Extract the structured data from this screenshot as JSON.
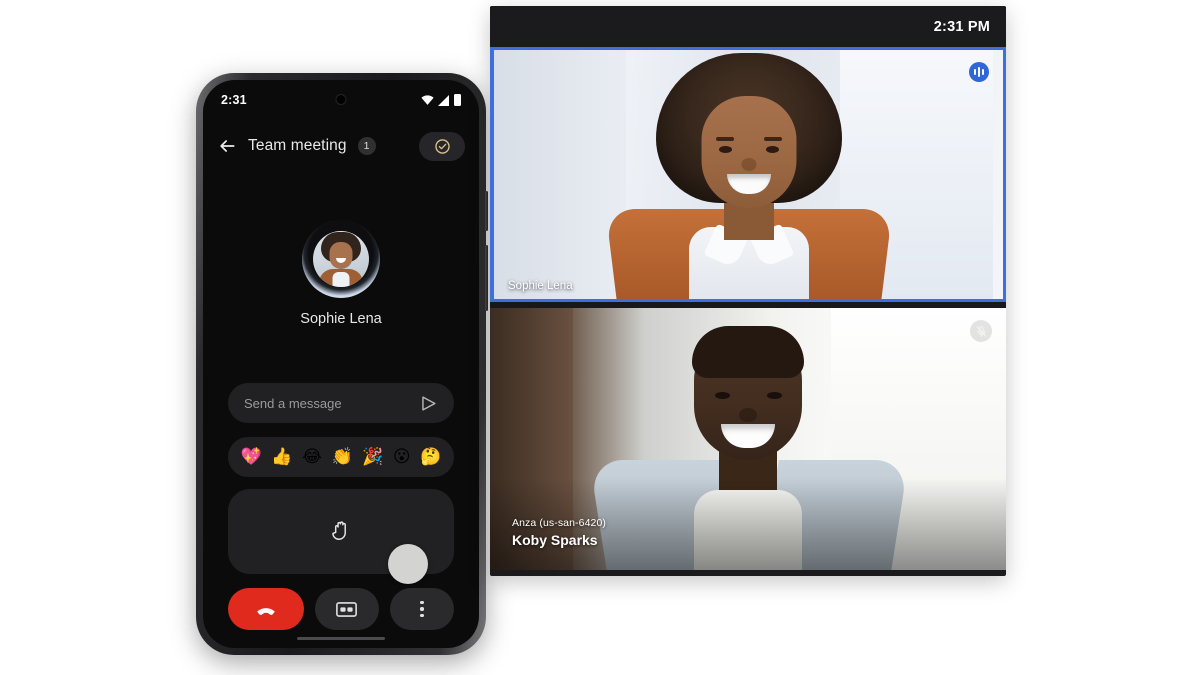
{
  "phone": {
    "status_bar": {
      "time": "2:31",
      "icons": [
        "wifi-icon",
        "signal-icon",
        "battery-icon"
      ]
    },
    "app_bar": {
      "back_icon": "back-arrow-icon",
      "title": "Team meeting",
      "participant_count": "1",
      "safety_icon": "check-circle-icon",
      "safety_color": "#d8c28a"
    },
    "speaker": {
      "name": "Sophie Lena",
      "avatar": "participant-avatar",
      "speaking_ring": true
    },
    "message_bar": {
      "placeholder": "Send a message",
      "value": "",
      "send_icon": "send-icon"
    },
    "emoji_bar": {
      "items": [
        {
          "name": "sparkling-heart-emoji",
          "glyph": "💖"
        },
        {
          "name": "thumbs-up-emoji",
          "glyph": "👍"
        },
        {
          "name": "laughing-emoji",
          "glyph": "😂"
        },
        {
          "name": "clapping-emoji",
          "glyph": "👏"
        },
        {
          "name": "party-popper-emoji",
          "glyph": "🎉"
        },
        {
          "name": "surprised-emoji",
          "glyph": "😮"
        },
        {
          "name": "thinking-emoji",
          "glyph": "🤔"
        }
      ]
    },
    "hand_panel": {
      "icon": "raise-hand-icon",
      "cursor": "pointer-cursor-dot"
    },
    "call_controls": [
      {
        "name": "end-call-button",
        "icon": "hang-up-icon",
        "color": "#e02a1d"
      },
      {
        "name": "captions-button",
        "icon": "closed-captions-icon",
        "color": "#2a2a2d"
      },
      {
        "name": "more-options-button",
        "icon": "more-vertical-icon",
        "color": "#2a2a2d"
      }
    ]
  },
  "monitor": {
    "time": "2:31 PM",
    "tiles": [
      {
        "name": "video-tile-sophie",
        "label": "Sophie Lena",
        "sublabel": "",
        "active_speaker": true,
        "border_color": "#3f6fdc",
        "badge": "speaking-indicator-icon",
        "muted": false
      },
      {
        "name": "video-tile-koby",
        "label": "Koby Sparks",
        "sublabel": "Anza (us-san-6420)",
        "active_speaker": false,
        "border_color": "",
        "badge": "muted-microphone-icon",
        "muted": true
      }
    ]
  }
}
